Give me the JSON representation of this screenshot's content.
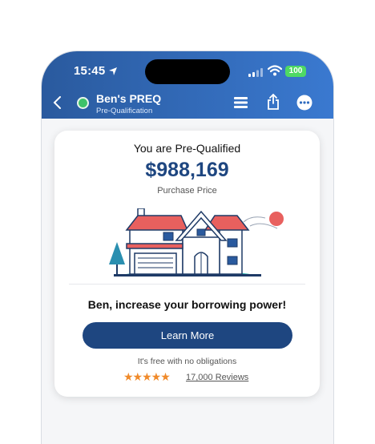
{
  "status_bar": {
    "time": "15:45",
    "battery": "100"
  },
  "header": {
    "title": "Ben's PREQ",
    "subtitle": "Pre-Qualification"
  },
  "card": {
    "title": "You are Pre-Qualified",
    "amount": "$988,169",
    "amount_label": "Purchase Price",
    "promo": "Ben, increase your borrowing power!",
    "button_label": "Learn More",
    "free_note": "It's free with no obligations",
    "rating": {
      "stars": "★★★★★",
      "reviews_label": "17,000 Reviews"
    }
  },
  "colors": {
    "header": "#2a5a9e",
    "accent": "#1e4680",
    "star": "#f08a2a",
    "status_dot": "#3ec26a"
  },
  "icons": [
    "location-arrow-icon",
    "signal-icon",
    "wifi-icon",
    "back-icon",
    "menu-icon",
    "share-icon",
    "more-icon",
    "house-illustration"
  ]
}
